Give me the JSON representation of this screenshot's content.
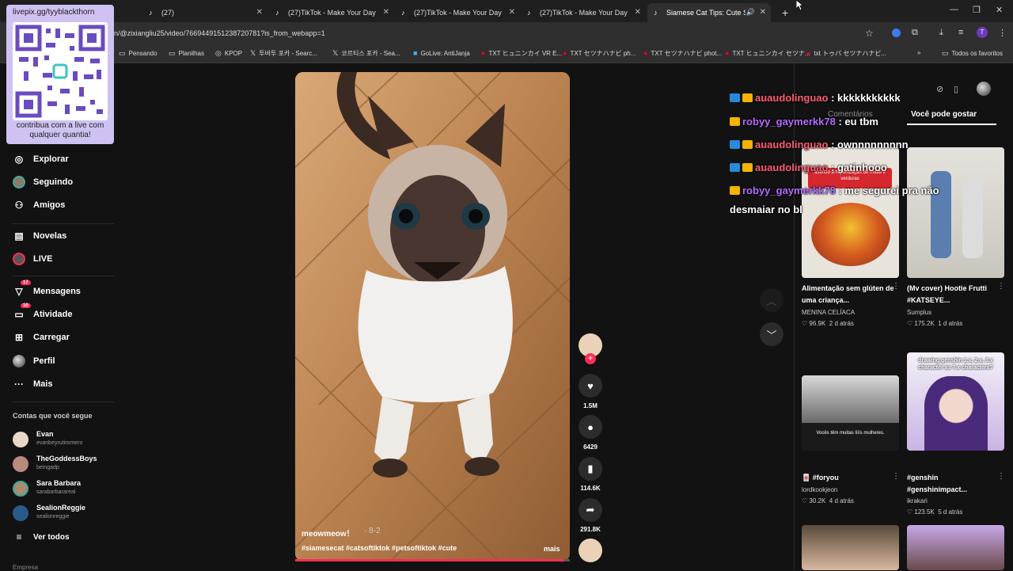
{
  "browser": {
    "tabs": [
      {
        "label": "(27)"
      },
      {
        "label": "(27)TikTok - Make Your Day"
      },
      {
        "label": "(27)TikTok - Make Your Day"
      },
      {
        "label": "(27)TikTok - Make Your Day"
      },
      {
        "label": "Siamese Cat Tips: Cute Siam"
      }
    ],
    "url": "n/@zixiangliu25/video/7669449151238720781?is_from_webapp=1",
    "bookmarks": [
      "Pensando",
      "Planilhas",
      "KPOP",
      "투바투 포카 - Searc...",
      "코르티스 포카 - Sea...",
      "GoLive: AntiJanja",
      "TXT ヒュニンカイ VR E...",
      "TXT セツナハナビ ph...",
      "TXT セツナハナビ phot...",
      "TXT ヒュニンカイ セツナ...",
      "txt トゥバ セツナハナビ..."
    ],
    "bookmarks_folder": "Todos os favoritos"
  },
  "qr_overlay": {
    "title": "livepix.gg/tyyblackthorn",
    "caption": "contribua com a live com qualquer quantia!"
  },
  "sidebar": {
    "nav": [
      {
        "label": "Explorar",
        "icon": "compass-icon"
      },
      {
        "label": "Seguindo",
        "icon": "avatar-icon"
      },
      {
        "label": "Amigos",
        "icon": "friends-icon"
      },
      {
        "label": "Novelas",
        "icon": "film-icon"
      },
      {
        "label": "LIVE",
        "icon": "live-icon"
      },
      {
        "label": "Mensagens",
        "icon": "send-icon",
        "badge": "17"
      },
      {
        "label": "Atividade",
        "icon": "inbox-icon",
        "badge": "10"
      },
      {
        "label": "Carregar",
        "icon": "plus-square-icon"
      },
      {
        "label": "Perfil",
        "icon": "profile-icon"
      },
      {
        "label": "Mais",
        "icon": "more-icon"
      }
    ],
    "following_header": "Contas que você segue",
    "following": [
      {
        "name": "Evan",
        "handle": "evanbeyrutiromero"
      },
      {
        "name": "TheGoddessBoys",
        "handle": "beingadp"
      },
      {
        "name": "Sara Barbara",
        "handle": "sarabarbarareal"
      },
      {
        "name": "SealionReggie",
        "handle": "sealionreggie"
      }
    ],
    "see_all": "Ver todos",
    "footer": "Empresa"
  },
  "video": {
    "author": "meowmeow！",
    "date": "· 8-2",
    "tags": "#siamesecat #catsoftiktok #petsoftiktok #cute",
    "more": "mais",
    "progress": 0.98
  },
  "actions": {
    "likes": "1.5M",
    "comments": "6429",
    "saves": "114.6K",
    "shares": "291.8K"
  },
  "right_panel": {
    "tab_comments": "Comentários",
    "tab_suggested": "Você pode gostar",
    "cards": [
      {
        "title": "Alimentação sem glúten de uma criança...",
        "author": "MENINA CELÍACA",
        "likes": "96.9K",
        "age": "2 d atrás",
        "thumb_text": "asendo a higienização de frutas e verduras"
      },
      {
        "title": "(Mv cover) Hootie Frutti #KATSEYE...",
        "author": "Sumplus",
        "likes": "175.2K",
        "age": "1 d atrás",
        "thumb_text": ""
      },
      {
        "title": "🀄 #foryou",
        "author": "lordkookjeon",
        "likes": "30.2K",
        "age": "4 d atrás",
        "thumb_text": "Vocês têm muitas lííís mulheres."
      },
      {
        "title": "#genshin #genshinimpact...",
        "author": "ikrakari",
        "likes": "123.5K",
        "age": "5 d atrás",
        "thumb_text": "drawing genshin 1.x, 2.x, 3.x character as 7.x characters?"
      }
    ]
  },
  "chat": [
    {
      "user": "auaudolinguao",
      "message": ": kkkkkkkkkkk",
      "color": "#ff5f73"
    },
    {
      "user": "robyy_gaymerkk78",
      "message": ": eu tbm",
      "color": "#b46cff"
    },
    {
      "user": "auaudolinguao",
      "message": ": ownnnnnnnnn",
      "color": "#ff5f73"
    },
    {
      "user": "auaudolinguao",
      "message": ": gatinhooo",
      "color": "#ff5f73"
    },
    {
      "user": "robyy_gaymerkk78",
      "message": ": me segurei pra não",
      "color": "#b46cff"
    }
  ],
  "chat_continuation": "desmaiar no bl",
  "colors": {
    "accent": "#fe2c55",
    "background": "#121212"
  }
}
